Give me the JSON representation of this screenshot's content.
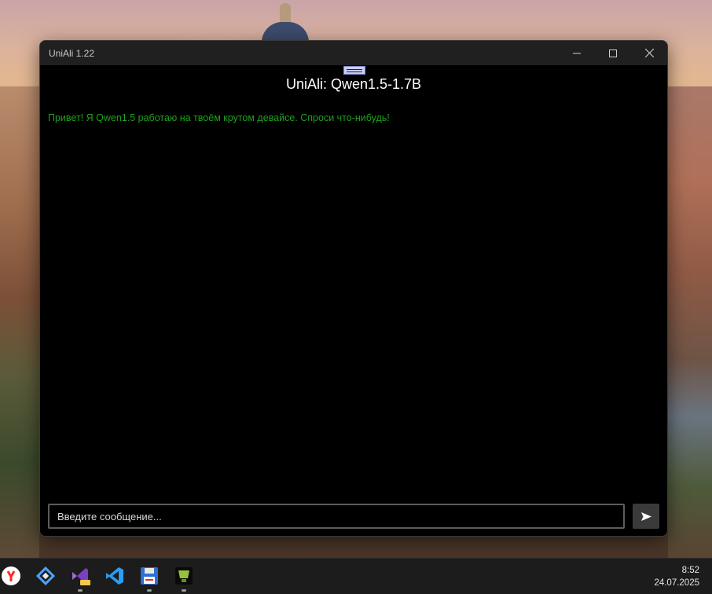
{
  "window": {
    "title": "UniAli 1.22"
  },
  "chat": {
    "title": "UniAli: Qwen1.5-1.7B",
    "messages": [
      {
        "role": "assistant",
        "text": "Привет! Я Qwen1.5 работаю на твоём крутом девайсе. Спроси что-нибудь!",
        "color": "#1fa01f"
      }
    ],
    "input": {
      "value": "",
      "placeholder": "Введите сообщение..."
    },
    "send_icon": "send-arrow-icon"
  },
  "taskbar": {
    "apps": [
      {
        "name": "yandex-browser",
        "icon": "yandex-browser-icon",
        "running": false
      },
      {
        "name": "app-diamond",
        "icon": "diamond-app-icon",
        "running": false
      },
      {
        "name": "visual-studio-preview",
        "icon": "visual-studio-icon",
        "running": true
      },
      {
        "name": "vscode",
        "icon": "vscode-icon",
        "running": false
      },
      {
        "name": "save-app",
        "icon": "floppy-disk-icon",
        "running": true
      },
      {
        "name": "uniali",
        "icon": "uniali-app-icon",
        "running": true
      }
    ],
    "clock": {
      "time": "8:52",
      "date": "24.07.2025"
    }
  },
  "colors": {
    "accent_green": "#1fa01f",
    "window_bg": "#000000",
    "titlebar_bg": "#202020"
  }
}
